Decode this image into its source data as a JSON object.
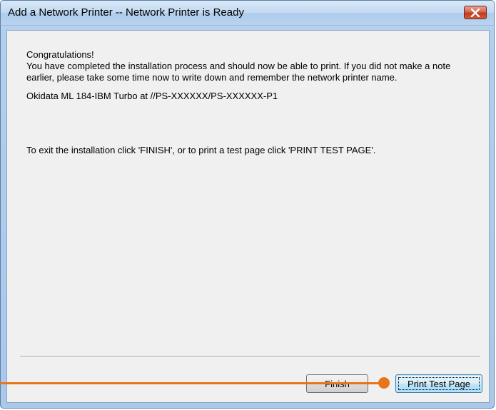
{
  "window": {
    "title": "Add a Network Printer -- Network Printer is Ready",
    "close_icon": "close-icon"
  },
  "content": {
    "heading": "Congratulations!",
    "body": "You have completed the installation process and should now be able to print. If you did not make a note earlier, please take some time now to write down and remember the network printer name.",
    "printer_name": "Okidata ML 184-IBM Turbo at //PS-XXXXXX/PS-XXXXXX-P1",
    "instructions": "To exit the installation click 'FINISH', or to print a test page click 'PRINT TEST PAGE'."
  },
  "buttons": {
    "finish_label": "Finish",
    "print_test_page_label": "Print Test Page"
  },
  "colors": {
    "callout": "#e8751a",
    "close_button": "#c23a1f"
  }
}
